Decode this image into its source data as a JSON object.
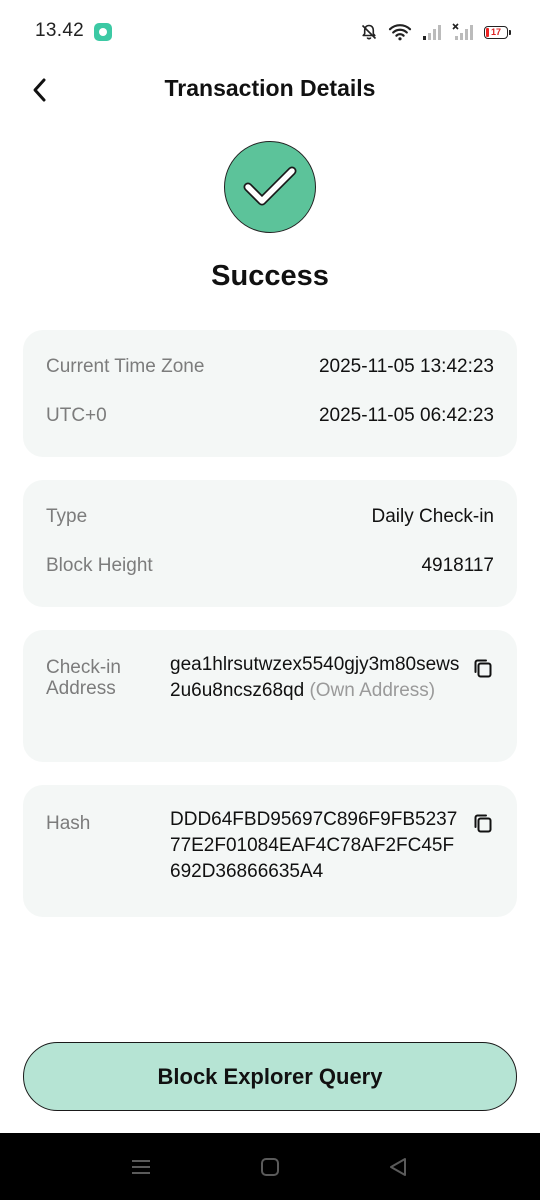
{
  "status_bar": {
    "time": "13.42",
    "battery_level": "17",
    "icons": [
      "app-notification-icon",
      "bell-muted-icon",
      "wifi-icon",
      "signal-icon",
      "signal-no-service-icon",
      "battery-icon"
    ]
  },
  "header": {
    "title": "Transaction Details",
    "back_icon": "back-arrow-icon"
  },
  "status": {
    "text": "Success",
    "icon": "check-circle-icon",
    "color": "#5cc39a"
  },
  "time_card": {
    "rows": [
      {
        "label": "Current Time Zone",
        "value": "2025-11-05 13:42:23"
      },
      {
        "label": "UTC+0",
        "value": "2025-11-05 06:42:23"
      }
    ]
  },
  "type_card": {
    "rows": [
      {
        "label": "Type",
        "value": "Daily Check-in"
      },
      {
        "label": "Block Height",
        "value": "4918117"
      }
    ]
  },
  "address_card": {
    "label": "Check-in Address",
    "value": "gea1hlrsutwzex5540gjy3m80sews2u6u8ncsz68qd",
    "own_tag": "(Own Address)",
    "copy_icon": "copy-icon"
  },
  "hash_card": {
    "label": "Hash",
    "value": "DDD64FBD95697C896F9FB523777E2F01084EAF4C78AF2FC45F692D36866635A4",
    "copy_icon": "copy-icon"
  },
  "footer": {
    "explorer_button": "Block Explorer Query",
    "button_color": "#b6e4d4"
  },
  "nav_bar": {
    "icons": [
      "menu-icon",
      "home-icon",
      "back-triangle-icon"
    ]
  }
}
